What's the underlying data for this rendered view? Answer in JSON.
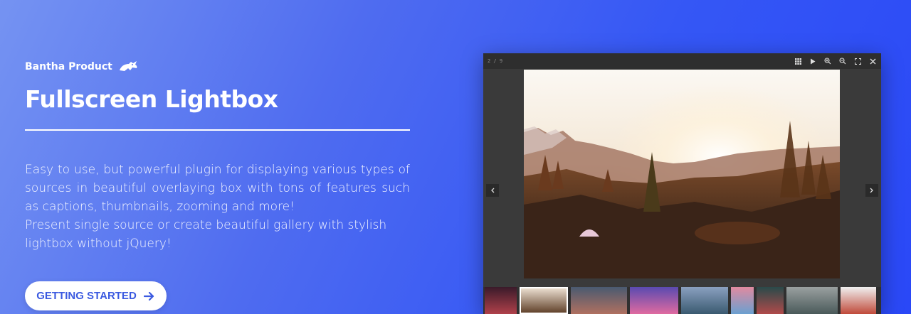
{
  "brand": {
    "name": "Bantha Product",
    "icon": "bantha-logo-icon"
  },
  "hero": {
    "title": "Fullscreen Lightbox",
    "description_line1": "Easy to use, but powerful plugin for displaying various types of sources in beautiful overlaying box with tons of features such as captions, thumbnails, zooming and more!",
    "description_line2": "Present single source or create beautiful gallery with stylish lightbox without jQuery!",
    "cta_label": "GETTING STARTED",
    "cta_icon": "arrow-right-icon"
  },
  "lightbox": {
    "counter": "2 / 9",
    "tools": [
      "thumbnails-icon",
      "play-icon",
      "zoom-in-icon",
      "zoom-out-icon",
      "fullscreen-icon",
      "close-icon"
    ],
    "prev_icon": "chevron-left-icon",
    "next_icon": "chevron-right-icon",
    "thumbnails": [
      {
        "name": "bokeh-lights",
        "c1": "#3a1a2a",
        "c2": "#b0404a"
      },
      {
        "name": "mountain-sunset",
        "c1": "#f2e6d8",
        "c2": "#5a3a22"
      },
      {
        "name": "city-evening",
        "c1": "#4a5a70",
        "c2": "#b07060"
      },
      {
        "name": "purple-lake",
        "c1": "#5a4ab0",
        "c2": "#e06aa0"
      },
      {
        "name": "misty-mountains",
        "c1": "#8aa0c0",
        "c2": "#3a5a70"
      },
      {
        "name": "pink-sky",
        "c1": "#e08aa0",
        "c2": "#6aa0d0"
      },
      {
        "name": "teal-forest",
        "c1": "#2a4a4a",
        "c2": "#b04a4a"
      },
      {
        "name": "grey-landscape",
        "c1": "#9aa0a0",
        "c2": "#4a5a5a"
      },
      {
        "name": "red-hiker",
        "c1": "#f0f0f0",
        "c2": "#c04a3a"
      }
    ]
  },
  "colors": {
    "accent": "#3b5ae0",
    "gradient_start": "#7593f2",
    "gradient_end": "#2a48f7"
  }
}
